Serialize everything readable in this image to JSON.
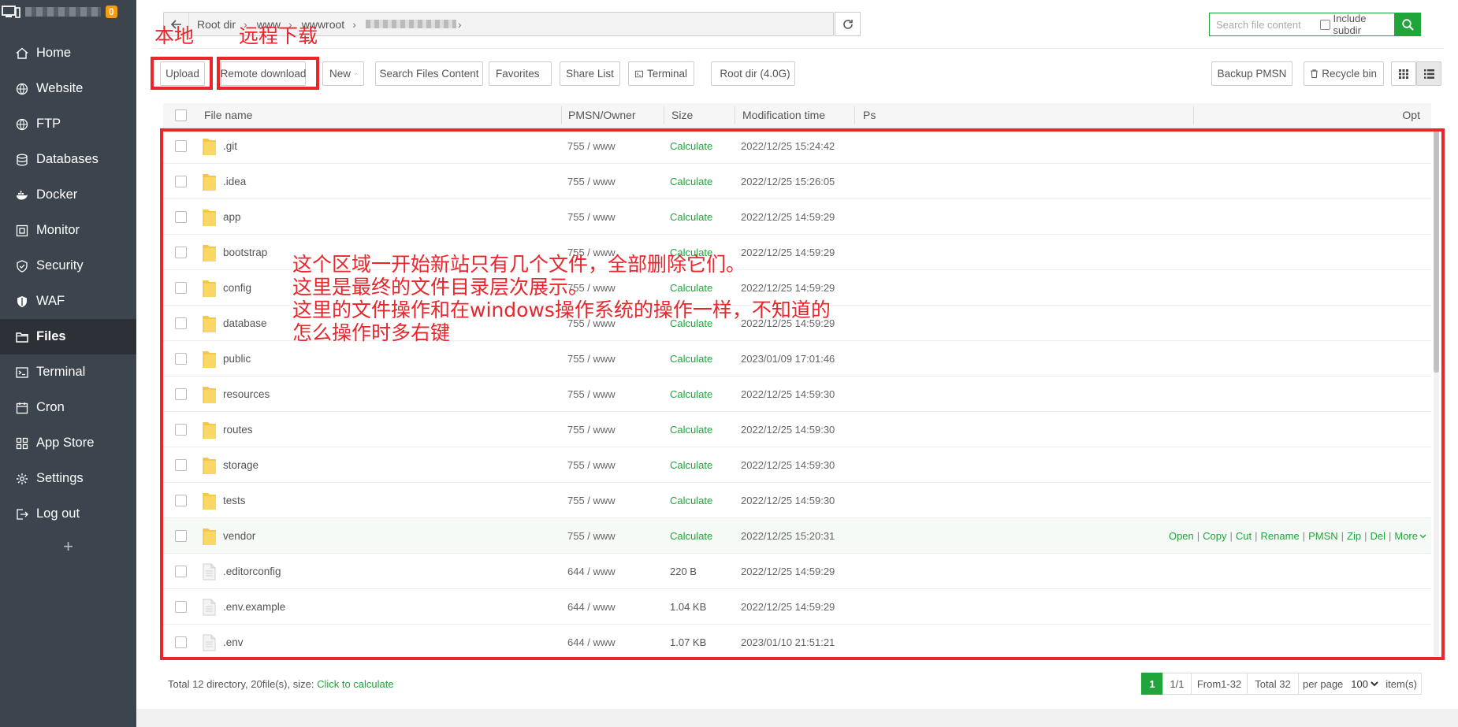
{
  "sidebar": {
    "badge": "0",
    "items": [
      {
        "label": "Home",
        "icon": "home-icon"
      },
      {
        "label": "Website",
        "icon": "globe-icon"
      },
      {
        "label": "FTP",
        "icon": "globe-icon"
      },
      {
        "label": "Databases",
        "icon": "database-icon"
      },
      {
        "label": "Docker",
        "icon": "docker-icon"
      },
      {
        "label": "Monitor",
        "icon": "monitor-icon"
      },
      {
        "label": "Security",
        "icon": "shield-icon"
      },
      {
        "label": "WAF",
        "icon": "waf-shield-icon"
      },
      {
        "label": "Files",
        "icon": "folder-icon"
      },
      {
        "label": "Terminal",
        "icon": "terminal-icon"
      },
      {
        "label": "Cron",
        "icon": "calendar-icon"
      },
      {
        "label": "App Store",
        "icon": "apps-icon"
      },
      {
        "label": "Settings",
        "icon": "gear-icon"
      },
      {
        "label": "Log out",
        "icon": "logout-icon"
      }
    ],
    "add_label": "+"
  },
  "path": {
    "root": "Root dir",
    "seg1": "www",
    "seg2": "wwwroot"
  },
  "search": {
    "placeholder": "Search file content",
    "include_subdir": "Include subdir"
  },
  "toolbar": {
    "upload": "Upload",
    "remote_download": "Remote download",
    "new": "New",
    "search_files": "Search Files Content",
    "favorites": "Favorites",
    "share_list": "Share List",
    "terminal": "Terminal",
    "root_dir": "Root dir (4.0G)",
    "backup": "Backup PMSN",
    "recycle": "Recycle bin"
  },
  "annotations": {
    "local": "本地",
    "remote": "远程下载",
    "note_line1": "这个区域一开始新站只有几个文件，全部删除它们。",
    "note_line2": "这里是最终的文件目录层次展示。",
    "note_line3": "这里的文件操作和在windows操作系统的操作一样，不知道的",
    "note_line4": "怎么操作时多右键"
  },
  "table": {
    "headers": {
      "name": "File name",
      "perm": "PMSN/Owner",
      "size": "Size",
      "mtime": "Modification time",
      "ps": "Ps",
      "opt": "Opt"
    },
    "rows": [
      {
        "name": ".git",
        "type": "folder",
        "perm": "755 / www",
        "size": "Calculate",
        "mtime": "2022/12/25 15:24:42"
      },
      {
        "name": ".idea",
        "type": "folder",
        "perm": "755 / www",
        "size": "Calculate",
        "mtime": "2022/12/25 15:26:05"
      },
      {
        "name": "app",
        "type": "folder",
        "perm": "755 / www",
        "size": "Calculate",
        "mtime": "2022/12/25 14:59:29"
      },
      {
        "name": "bootstrap",
        "type": "folder",
        "perm": "755 / www",
        "size": "Calculate",
        "mtime": "2022/12/25 14:59:29"
      },
      {
        "name": "config",
        "type": "folder",
        "perm": "755 / www",
        "size": "Calculate",
        "mtime": "2022/12/25 14:59:29"
      },
      {
        "name": "database",
        "type": "folder",
        "perm": "755 / www",
        "size": "Calculate",
        "mtime": "2022/12/25 14:59:29"
      },
      {
        "name": "public",
        "type": "folder",
        "perm": "755 / www",
        "size": "Calculate",
        "mtime": "2023/01/09 17:01:46"
      },
      {
        "name": "resources",
        "type": "folder",
        "perm": "755 / www",
        "size": "Calculate",
        "mtime": "2022/12/25 14:59:30"
      },
      {
        "name": "routes",
        "type": "folder",
        "perm": "755 / www",
        "size": "Calculate",
        "mtime": "2022/12/25 14:59:30"
      },
      {
        "name": "storage",
        "type": "folder",
        "perm": "755 / www",
        "size": "Calculate",
        "mtime": "2022/12/25 14:59:30"
      },
      {
        "name": "tests",
        "type": "folder",
        "perm": "755 / www",
        "size": "Calculate",
        "mtime": "2022/12/25 14:59:30"
      },
      {
        "name": "vendor",
        "type": "folder",
        "perm": "755 / www",
        "size": "Calculate",
        "mtime": "2022/12/25 15:20:31",
        "hover": true
      },
      {
        "name": ".editorconfig",
        "type": "file",
        "perm": "644 / www",
        "size": "220 B",
        "mtime": "2022/12/25 14:59:29"
      },
      {
        "name": ".env.example",
        "type": "file",
        "perm": "644 / www",
        "size": "1.04 KB",
        "mtime": "2022/12/25 14:59:29"
      },
      {
        "name": ".env",
        "type": "file",
        "perm": "644 / www",
        "size": "1.07 KB",
        "mtime": "2023/01/10 21:51:21"
      }
    ],
    "row_actions": [
      "Open",
      "Copy",
      "Cut",
      "Rename",
      "PMSN",
      "Zip",
      "Del",
      "More"
    ]
  },
  "footer": {
    "summary": "Total 12 directory, 20file(s), size: ",
    "calc_link": "Click to calculate",
    "page": "1",
    "pages": "1/1",
    "range": "From1-32",
    "total": "Total 32",
    "per_page_label": "per page",
    "per_page_value": "100",
    "items_label": "item(s)"
  },
  "colors": {
    "accent": "#20a53a",
    "annotation": "#e8262c",
    "sidebar": "#3c444d"
  }
}
